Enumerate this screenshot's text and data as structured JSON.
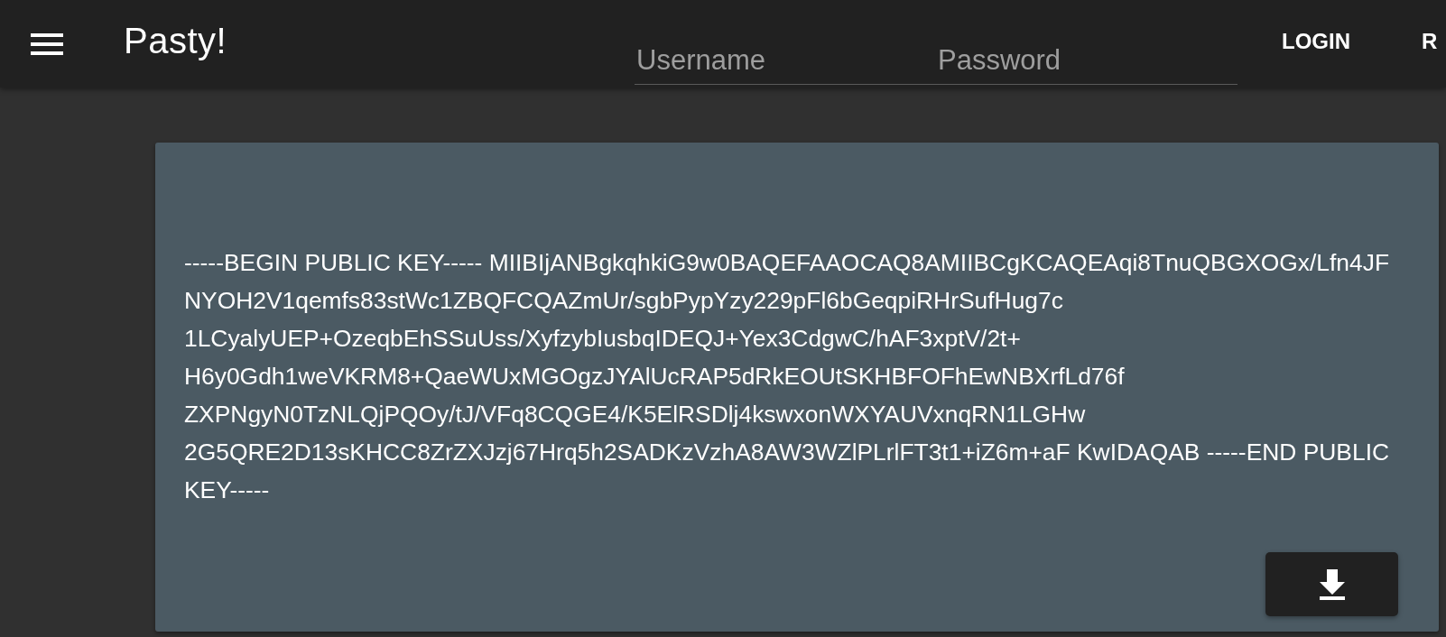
{
  "app_bar": {
    "title": "Pasty!",
    "username": {
      "placeholder": "Username"
    },
    "password": {
      "placeholder": "Password"
    },
    "buttons": [
      "LOGIN",
      "R"
    ]
  },
  "key_card": {
    "text": "-----BEGIN PUBLIC KEY----- MIIBIjANBgkqhkiG9w0BAQEFAAOCAQ8AMIIBCgKCAQEAqi8TnuQBGXOGx/Lfn4JF NYOH2V1qemfs83stWc1ZBQFCQAZmUr/sgbPypYzy229pFl6bGeqpiRHrSufHug7c 1LCyalyUEP+OzeqbEhSSuUss/XyfzybIusbqIDEQJ+Yex3CdgwC/hAF3xptV/2t+ H6y0Gdh1weVKRM8+QaeWUxMGOgzJYAlUcRAP5dRkEOUtSKHBFOFhEwNBXrfLd76f ZXPNgyN0TzNLQjPQOy/tJ/VFq8CQGE4/K5ElRSDlj4kswxonWXYAUVxnqRN1LGHw 2G5QRE2D13sKHCC8ZrZXJzj67Hrq5h2SADKzVzhA8AW3WZlPLrlFT3t1+iZ6m+aF KwIDAQAB -----END PUBLIC KEY-----"
  }
}
